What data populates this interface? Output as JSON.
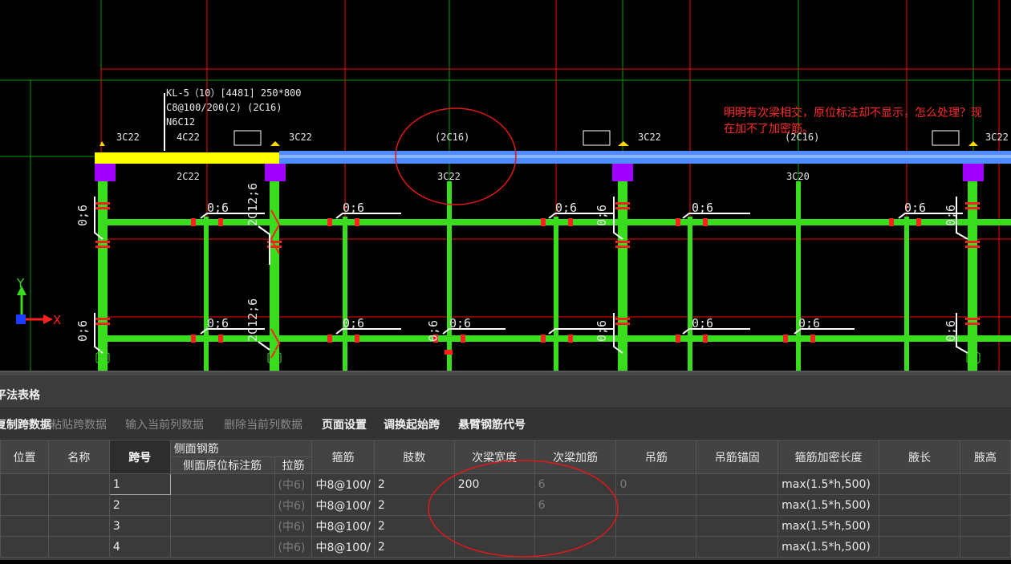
{
  "drawing": {
    "beam_label_lines": [
      "KL-5（10）[4481] 250*800",
      "C8@100/200(2) (2C16)",
      "N6C12"
    ],
    "top_labels": [
      "3C22",
      "4C22",
      "3C22",
      "(2C16)",
      "3C22",
      "(2C16)",
      "3C22"
    ],
    "bottom_labels": [
      "2C22",
      "3C22",
      "3C20"
    ],
    "rebar_labels": [
      "0;6",
      "0;6",
      "0;6",
      "0;6",
      "0;6",
      "0;6",
      "0;6",
      "0;6",
      "0;6",
      "0;6",
      "0;6",
      "0;6",
      "0;6",
      "0;6",
      "0;6",
      "0;6",
      "0;6",
      "0;6"
    ],
    "side_labels": [
      "2C12;6",
      "2C12;6"
    ],
    "annotation_note": "明明有次梁相交，原位标注却不显示，怎么处理？现在加不了加密筋。",
    "axis_y": "Y",
    "axis_x": "X",
    "colors": {
      "beam_yellow": "#ffff00",
      "beam_blue": "#4f8cff",
      "column": "#a000ff",
      "rebar_green": "#3adc1e",
      "grid_red": "#ff0000",
      "grid_green": "#00a800",
      "marker_red": "#ff2020"
    }
  },
  "panel": {
    "title": "平法表格",
    "toolbar": [
      {
        "label": "复制跨数据",
        "enabled": true
      },
      {
        "label": "粘贴跨数据",
        "enabled": false
      },
      {
        "label": "输入当前列数据",
        "enabled": false
      },
      {
        "label": "删除当前列数据",
        "enabled": false
      },
      {
        "label": "页面设置",
        "enabled": true
      },
      {
        "label": "调换起始跨",
        "enabled": true
      },
      {
        "label": "悬臂钢筋代号",
        "enabled": true
      }
    ],
    "headers": {
      "position": "位置",
      "name": "名称",
      "span": "跨号",
      "side_group": "侧面钢筋",
      "side_inplace": "侧面原位标注筋",
      "tie": "拉筋",
      "stirrup": "箍筋",
      "legs": "肢数",
      "sec_width": "次梁宽度",
      "sec_add": "次梁加筋",
      "hanger": "吊筋",
      "hanger_anchor": "吊筋锚固",
      "dense_len": "箍筋加密长度",
      "haunch_len": "腋长",
      "haunch_h": "腋高"
    },
    "rows": [
      {
        "span": "1",
        "tie": "(中6)",
        "stirrup": "中8@100/",
        "legs": "2",
        "sec_width": "200",
        "sec_add": "6",
        "hanger": "0",
        "dense_len": "max(1.5*h,500)"
      },
      {
        "span": "2",
        "tie": "(中6)",
        "stirrup": "中8@100/",
        "legs": "2",
        "sec_width": "",
        "sec_add": "6",
        "hanger": "",
        "dense_len": "max(1.5*h,500)"
      },
      {
        "span": "3",
        "tie": "(中6)",
        "stirrup": "中8@100/",
        "legs": "2",
        "sec_width": "",
        "sec_add": "",
        "hanger": "",
        "dense_len": "max(1.5*h,500)"
      },
      {
        "span": "4",
        "tie": "(中6)",
        "stirrup": "中8@100/",
        "legs": "2",
        "sec_width": "",
        "sec_add": "",
        "hanger": "",
        "dense_len": "max(1.5*h,500)"
      }
    ]
  }
}
